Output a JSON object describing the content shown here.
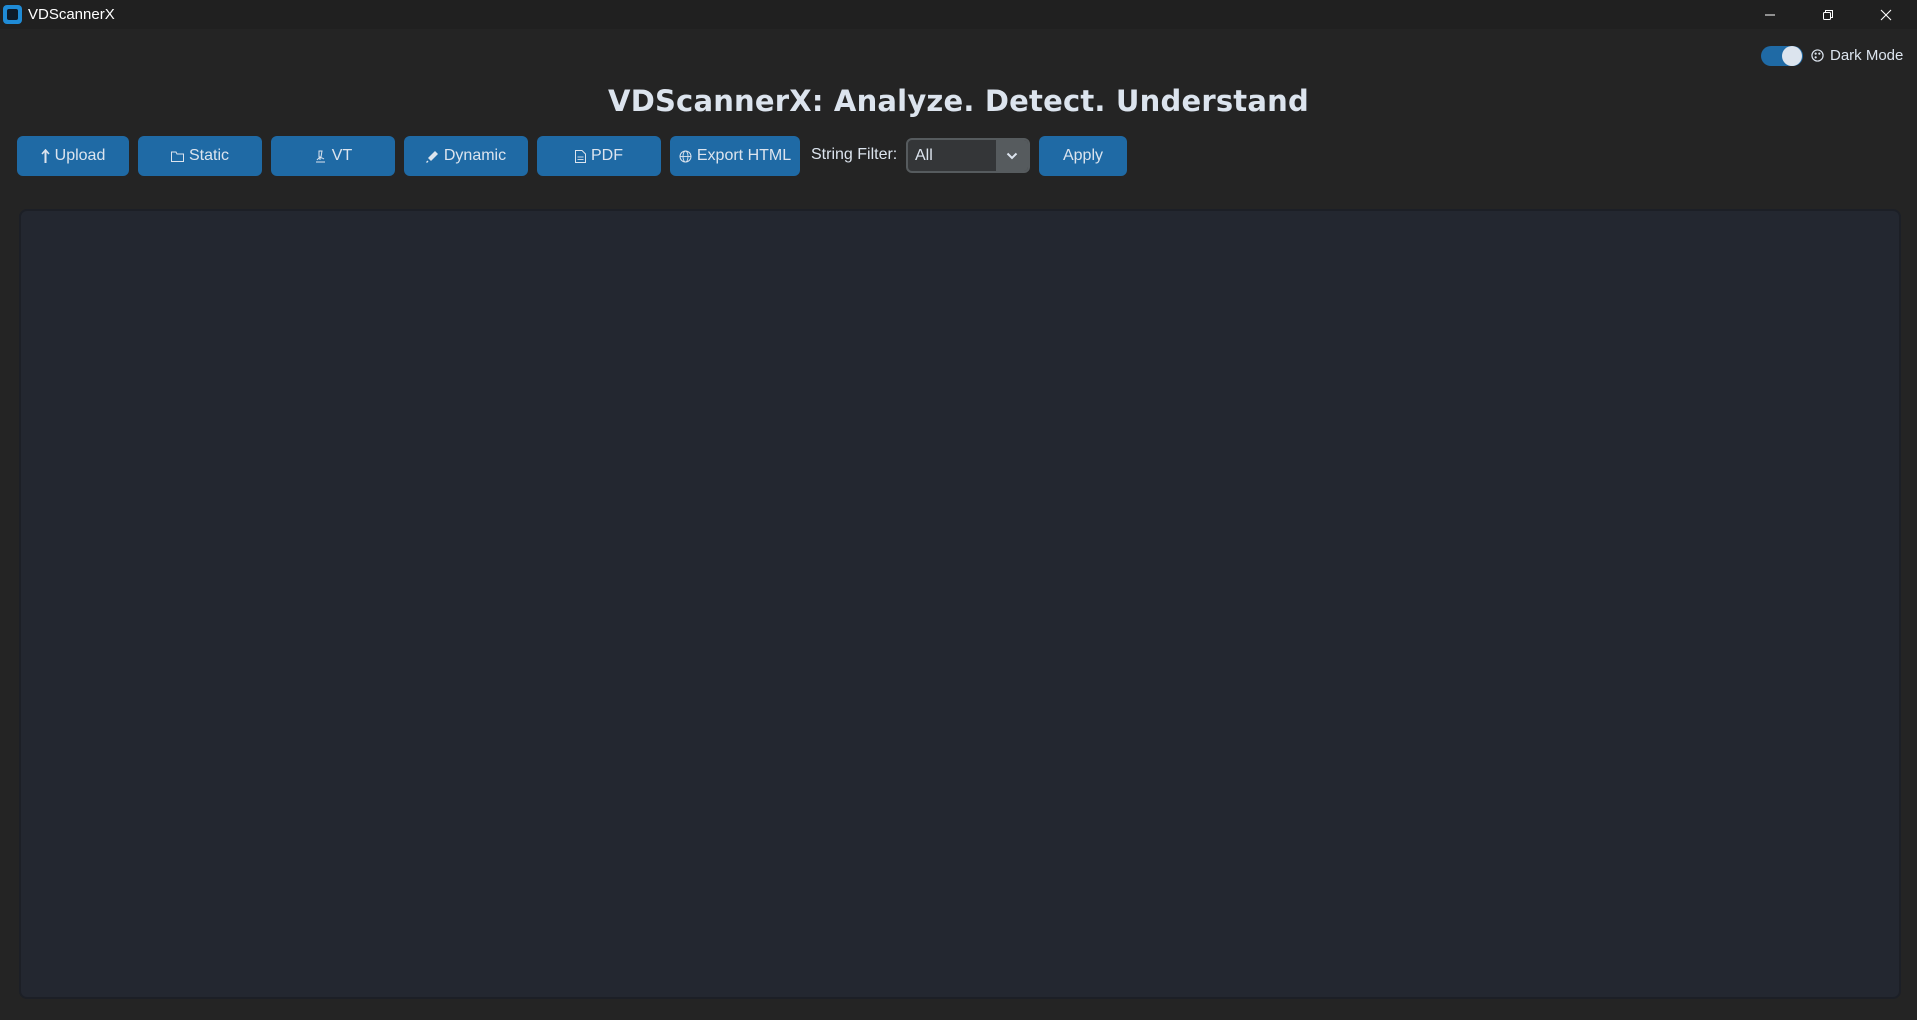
{
  "window": {
    "title": "VDScannerX",
    "controls": [
      "minimize-icon",
      "restore-icon",
      "close-icon"
    ]
  },
  "theme": {
    "label": "Dark Mode",
    "enabled": true,
    "accent": "#1f6aa5",
    "background": "#242424",
    "panel": "#232730"
  },
  "header": {
    "title": "VDScannerX: Analyze. Detect. Understand"
  },
  "toolbar": {
    "upload_label": "Upload",
    "static_label": "Static",
    "vt_label": "VT",
    "dynamic_label": "Dynamic",
    "pdf_label": "PDF",
    "export_label": "Export HTML",
    "filter_label": "String Filter:",
    "filter_value": "All",
    "apply_label": "Apply"
  },
  "output": {
    "text": ""
  }
}
